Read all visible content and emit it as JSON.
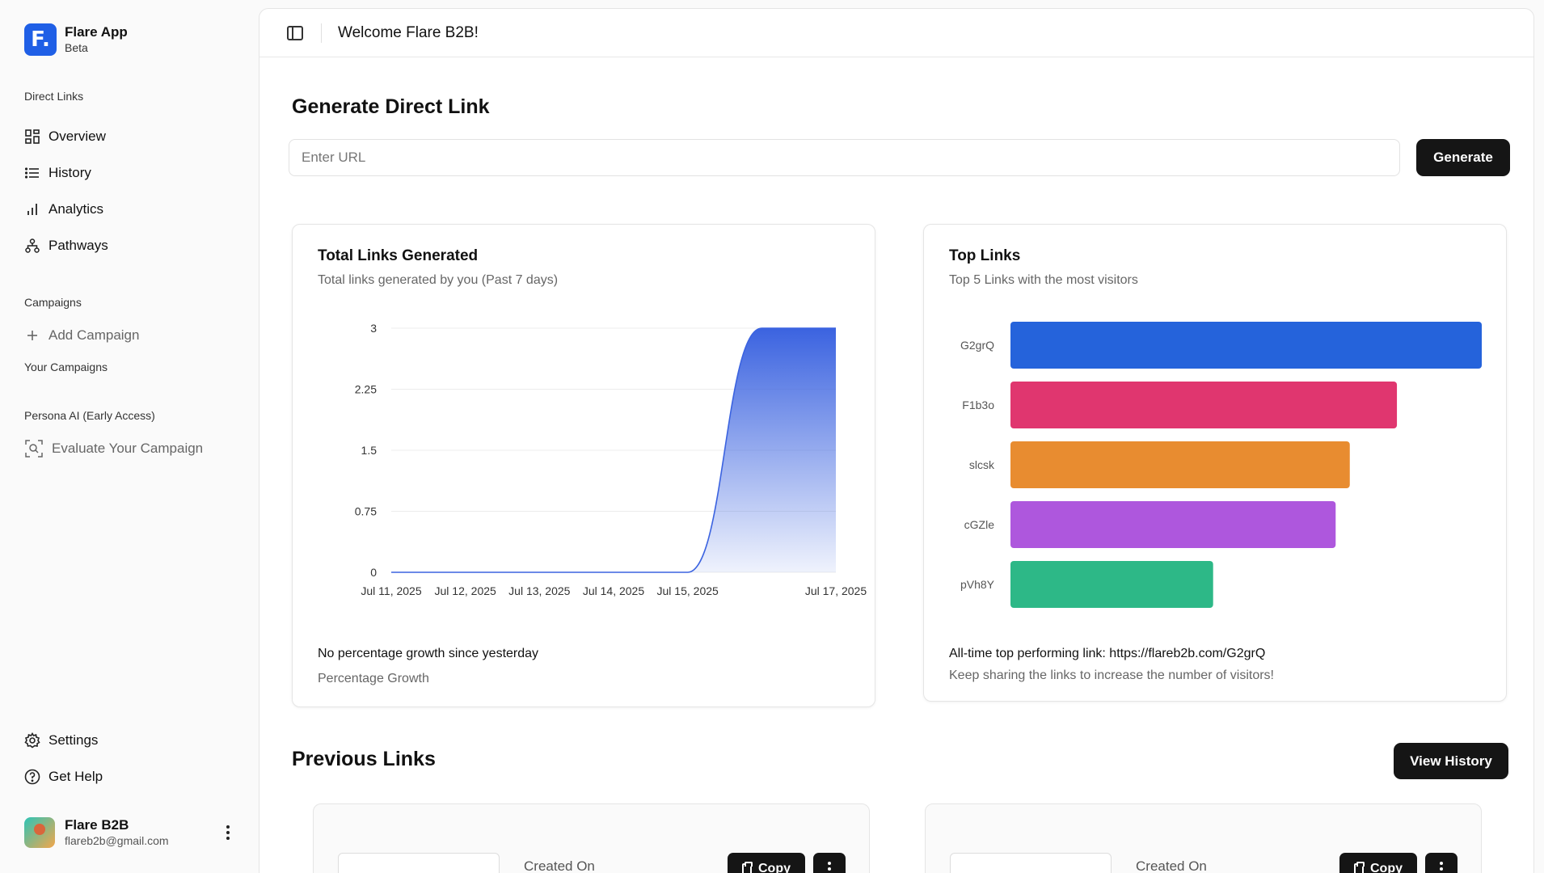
{
  "brand": {
    "logo_letter": "F.",
    "name": "Flare App",
    "sub": "Beta"
  },
  "sidebar": {
    "direct_links_label": "Direct Links",
    "items": [
      {
        "label": "Overview",
        "icon": "grid-icon"
      },
      {
        "label": "History",
        "icon": "list-icon"
      },
      {
        "label": "Analytics",
        "icon": "bar-chart-icon"
      },
      {
        "label": "Pathways",
        "icon": "sitemap-icon"
      }
    ],
    "campaigns_label": "Campaigns",
    "add_campaign": "Add Campaign",
    "your_campaigns_label": "Your Campaigns",
    "persona_label": "Persona AI (Early Access)",
    "evaluate": "Evaluate Your Campaign",
    "settings": "Settings",
    "help": "Get Help"
  },
  "user": {
    "name": "Flare B2B",
    "email": "flareb2b@gmail.com"
  },
  "topbar": {
    "title": "Welcome Flare B2B!"
  },
  "generate": {
    "heading": "Generate Direct Link",
    "placeholder": "Enter URL",
    "value": "",
    "button": "Generate"
  },
  "total_card": {
    "title": "Total Links Generated",
    "subtitle": "Total links generated by you (Past 7 days)",
    "footer_main": "No percentage growth since yesterday",
    "footer_sub": "Percentage Growth"
  },
  "top_card": {
    "title": "Top Links",
    "subtitle": "Top 5 Links with the most visitors",
    "footer_main": "All-time top performing link: https://flareb2b.com/G2grQ",
    "footer_sub": "Keep sharing the links to increase the number of visitors!"
  },
  "previous": {
    "heading": "Previous Links",
    "view_history": "View History",
    "cards": [
      {
        "created_label": "Created On",
        "copy": "Copy"
      },
      {
        "created_label": "Created On",
        "copy": "Copy"
      }
    ]
  },
  "chart_data": [
    {
      "type": "area",
      "x": [
        "Jul 11, 2025",
        "Jul 12, 2025",
        "Jul 13, 2025",
        "Jul 14, 2025",
        "Jul 15, 2025",
        "Jul 16, 2025",
        "Jul 17, 2025"
      ],
      "x_tick_labels": [
        "Jul 11, 2025",
        "Jul 12, 2025",
        "Jul 13, 2025",
        "Jul 14, 2025",
        "Jul 15, 2025",
        "",
        "Jul 17, 2025"
      ],
      "values": [
        0,
        0,
        0,
        0,
        0,
        3,
        3
      ],
      "yticks": [
        0,
        0.75,
        1.5,
        2.25,
        3
      ],
      "ylim": [
        0,
        3
      ],
      "grid": true,
      "color": "#3b63e0"
    },
    {
      "type": "bar",
      "orientation": "horizontal",
      "categories": [
        "G2grQ",
        "F1b3o",
        "slcsk",
        "cGZle",
        "pVh8Y"
      ],
      "values": [
        10,
        8.2,
        7.2,
        6.9,
        4.3
      ],
      "colors": [
        "#2563db",
        "#e0366f",
        "#e88c30",
        "#ae57dd",
        "#2db887"
      ],
      "grid": false
    }
  ]
}
